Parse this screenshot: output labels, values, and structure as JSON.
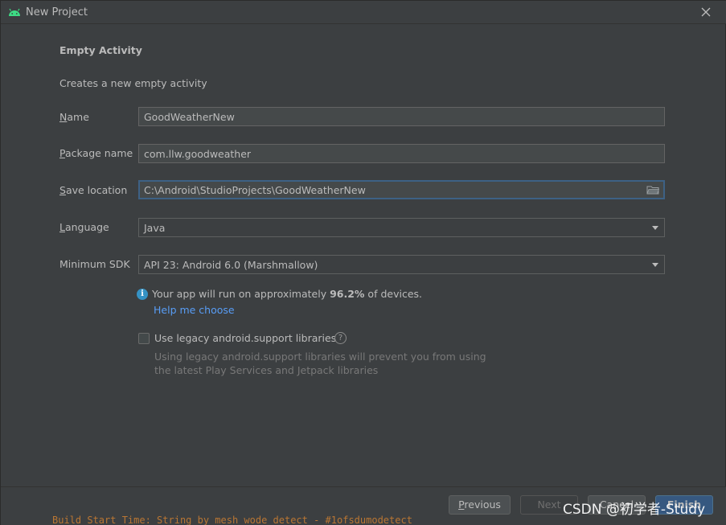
{
  "window": {
    "title": "New Project"
  },
  "form": {
    "heading": "Empty Activity",
    "description": "Creates a new empty activity",
    "name": {
      "label_mnemonic": "N",
      "label_rest": "ame",
      "value": "GoodWeatherNew"
    },
    "package": {
      "label_mnemonic": "P",
      "label_rest": "ackage name",
      "value": "com.llw.goodweather"
    },
    "save_location": {
      "label_mnemonic": "S",
      "label_rest": "ave location",
      "value": "C:\\Android\\StudioProjects\\GoodWeatherNew"
    },
    "language": {
      "label_mnemonic": "L",
      "label_rest": "anguage",
      "value": "Java"
    },
    "min_sdk": {
      "label": "Minimum SDK",
      "value": "API 23: Android 6.0 (Marshmallow)"
    }
  },
  "info": {
    "prefix": "Your app will run on approximately ",
    "percent": "96.2%",
    "suffix": " of devices.",
    "help_link": "Help me choose"
  },
  "legacy": {
    "label": "Use legacy android.support libraries",
    "checked": false,
    "hint_line1": "Using legacy android.support libraries will prevent you from using",
    "hint_line2": "the latest Play Services and Jetpack libraries"
  },
  "buttons": {
    "previous_mnemonic": "P",
    "previous_rest": "revious",
    "next": "Next",
    "cancel": "Cancel",
    "finish": "Finish"
  },
  "watermark": "CSDN @初学者-Study",
  "background_code": "Build Start Time: String by mesh wode detect - #1ofsdumodetect",
  "colors": {
    "background": "#3c3f41",
    "field_bg": "#45494a",
    "focus_border": "#3d6185",
    "link": "#589df6",
    "info_icon": "#3592c4",
    "default_button": "#365880"
  }
}
